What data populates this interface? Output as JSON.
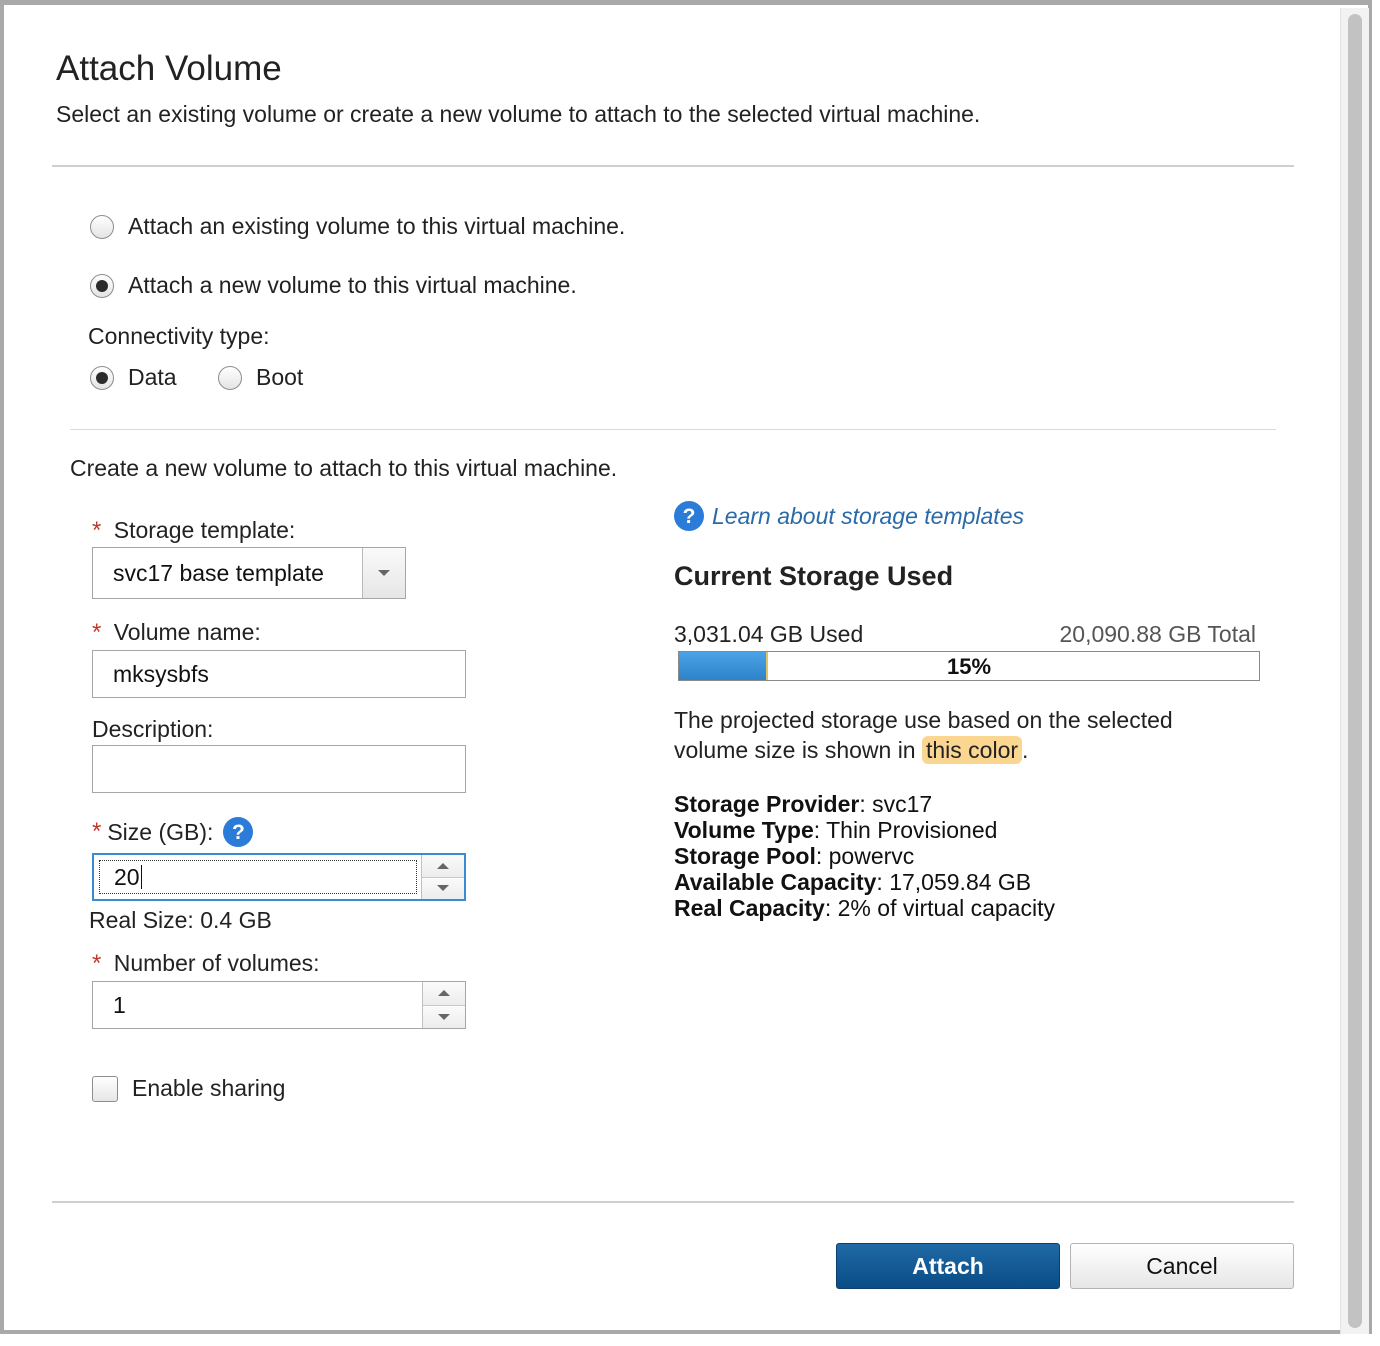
{
  "dialog": {
    "title": "Attach Volume",
    "subtitle": "Select an existing volume or create a new volume to attach to the selected virtual machine."
  },
  "attach_options": [
    {
      "label": "Attach an existing volume to this virtual machine.",
      "selected": false
    },
    {
      "label": "Attach a new volume to this virtual machine.",
      "selected": true
    }
  ],
  "connectivity": {
    "label": "Connectivity type:",
    "options": [
      {
        "label": "Data",
        "selected": true
      },
      {
        "label": "Boot",
        "selected": false
      }
    ]
  },
  "section_title": "Create a new volume to attach to this virtual machine.",
  "form": {
    "required_mark": "*",
    "storage_template": {
      "label": "Storage template:",
      "value": "svc17 base template"
    },
    "volume_name": {
      "label": "Volume name:",
      "value": "mksysbfs"
    },
    "description": {
      "label": "Description:",
      "value": ""
    },
    "size": {
      "label": "Size (GB):",
      "value": "20",
      "help": "?"
    },
    "real_size": "Real Size: 0.4 GB",
    "number_of_volumes": {
      "label": "Number of volumes:",
      "value": "1"
    },
    "enable_sharing": {
      "label": "Enable sharing",
      "checked": false
    }
  },
  "storage_info": {
    "help": "?",
    "learn_link": "Learn about storage templates",
    "heading": "Current Storage Used",
    "used": "3,031.04 GB Used",
    "total": "20,090.88 GB Total",
    "percent_label": "15%",
    "percent_value": 15,
    "projected_text": "The projected storage use based on the selected volume size is shown in",
    "projected_highlight": "this color",
    "projected_end": ".",
    "details": [
      {
        "key": "Storage Provider",
        "value": ": svc17"
      },
      {
        "key": "Volume Type",
        "value": ": Thin Provisioned"
      },
      {
        "key": "Storage Pool",
        "value": ": powervc"
      },
      {
        "key": "Available Capacity",
        "value": ": 17,059.84 GB"
      },
      {
        "key": "Real Capacity",
        "value": ": 2% of virtual capacity"
      }
    ]
  },
  "buttons": {
    "attach": "Attach",
    "cancel": "Cancel"
  },
  "colors": {
    "primary_button": "#0a4c86",
    "accent_blue": "#2b7bd8",
    "progress_fill": "#3a90d6",
    "projected_highlight": "#fad691"
  }
}
